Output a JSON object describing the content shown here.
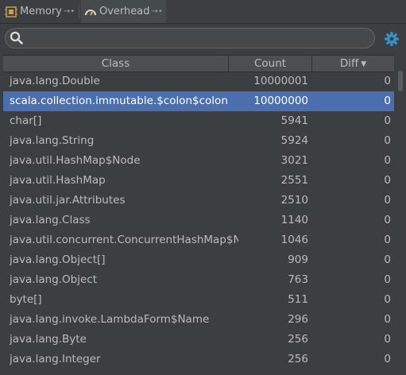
{
  "tabs": [
    {
      "label": "Memory",
      "icon": "memory-icon",
      "pin": "→•"
    },
    {
      "label": "Overhead",
      "icon": "gauge-icon",
      "pin": "→•"
    }
  ],
  "search": {
    "value": "",
    "placeholder": ""
  },
  "table": {
    "columns": [
      "Class",
      "Count",
      "Diff"
    ],
    "sort_column": "Diff",
    "sort_direction": "descending",
    "rows": [
      {
        "name": "java.lang.Double",
        "count": "10000001",
        "diff": "0"
      },
      {
        "name": "scala.collection.immutable.$colon$colon",
        "count": "10000000",
        "diff": "0",
        "selected": true
      },
      {
        "name": "char[]",
        "count": "5941",
        "diff": "0"
      },
      {
        "name": "java.lang.String",
        "count": "5924",
        "diff": "0"
      },
      {
        "name": "java.util.HashMap$Node",
        "count": "3021",
        "diff": "0"
      },
      {
        "name": "java.util.HashMap",
        "count": "2551",
        "diff": "0"
      },
      {
        "name": "java.util.jar.Attributes",
        "count": "2510",
        "diff": "0"
      },
      {
        "name": "java.lang.Class",
        "count": "1140",
        "diff": "0"
      },
      {
        "name": "java.util.concurrent.ConcurrentHashMap$N",
        "count": "1046",
        "diff": "0"
      },
      {
        "name": "java.lang.Object[]",
        "count": "909",
        "diff": "0"
      },
      {
        "name": "java.lang.Object",
        "count": "763",
        "diff": "0"
      },
      {
        "name": "byte[]",
        "count": "511",
        "diff": "0"
      },
      {
        "name": "java.lang.invoke.LambdaForm$Name",
        "count": "296",
        "diff": "0"
      },
      {
        "name": "java.lang.Byte",
        "count": "256",
        "diff": "0"
      },
      {
        "name": "java.lang.Integer",
        "count": "256",
        "diff": "0"
      }
    ]
  },
  "colors": {
    "background": "#3c3f41",
    "selection": "#4b6eaf",
    "text": "#bbbbbb",
    "accent": "#3592c4"
  }
}
